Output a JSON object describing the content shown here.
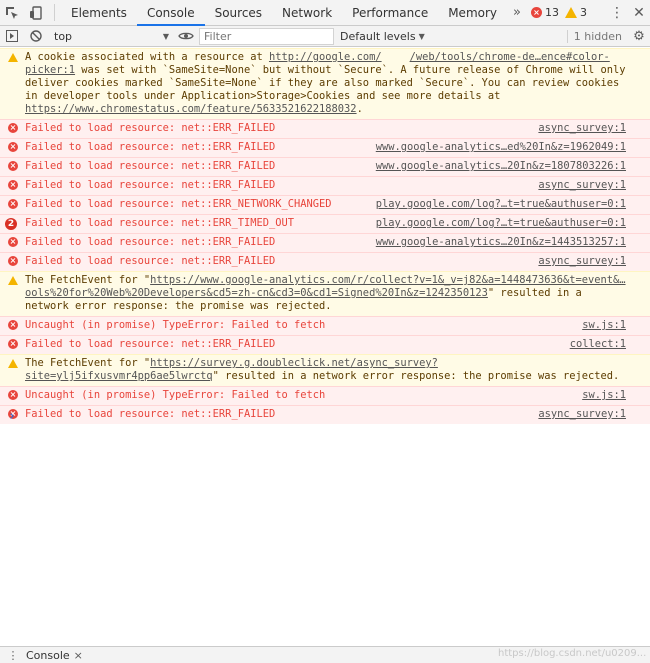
{
  "tabs": {
    "items": [
      "Elements",
      "Console",
      "Sources",
      "Network",
      "Performance",
      "Memory"
    ],
    "active": "Console",
    "more": "»"
  },
  "counters": {
    "errors": "13",
    "warnings": "3"
  },
  "toolbar": {
    "context": "top",
    "filter_placeholder": "Filter",
    "levels": "Default levels",
    "hidden": "1 hidden"
  },
  "messages": [
    {
      "type": "warning",
      "text_before": "A cookie associated with a resource at ",
      "link": "http://google.com/",
      "text_after": " was set with `SameSite=None` but without `Secure`. A future release of Chrome will only deliver cookies marked `SameSite=None` if they are also marked `Secure`. You can review cookies in developer tools under Application>Storage>Cookies and see more details at ",
      "link2": "https://www.chromestatus.com/feature/5633521622188032",
      "text_end": ".",
      "source": "/web/tools/chrome-de…ence#color-picker:1"
    },
    {
      "type": "error",
      "text": "Failed to load resource: net::ERR_FAILED",
      "source": "async_survey:1"
    },
    {
      "type": "error",
      "text": "Failed to load resource: net::ERR_FAILED",
      "source": "www.google-analytics…ed%20In&z=1962049:1"
    },
    {
      "type": "error",
      "text": "Failed to load resource: net::ERR_FAILED",
      "source": "www.google-analytics…20In&z=1807803226:1"
    },
    {
      "type": "error",
      "text": "Failed to load resource: net::ERR_FAILED",
      "source": "async_survey:1"
    },
    {
      "type": "error",
      "text": "Failed to load resource: net::ERR_NETWORK_CHANGED",
      "source": "play.google.com/log?…t=true&authuser=0:1"
    },
    {
      "type": "error-repeat",
      "count": "2",
      "text": "Failed to load resource: net::ERR_TIMED_OUT",
      "source": "play.google.com/log?…t=true&authuser=0:1"
    },
    {
      "type": "error",
      "text": "Failed to load resource: net::ERR_FAILED",
      "source": "www.google-analytics…20In&z=1443513257:1"
    },
    {
      "type": "error",
      "text": "Failed to load resource: net::ERR_FAILED",
      "source": "async_survey:1"
    },
    {
      "type": "warning",
      "text_before": "The FetchEvent for \"",
      "link": "https://www.google-analytics.com/r/collect?v=1&_v=j82&a=1448473636&t=event&…ools%20for%20Web%20Developers&cd5=zh-cn&cd3=0&cd1=Signed%20In&z=1242350123",
      "text_after": "\" resulted in a network error response: the promise was rejected.",
      "source": ""
    },
    {
      "type": "error",
      "text": "Uncaught (in promise) TypeError: Failed to fetch",
      "source": "sw.js:1"
    },
    {
      "type": "error",
      "text": "Failed to load resource: net::ERR_FAILED",
      "source": "collect:1"
    },
    {
      "type": "warning",
      "text_before": "The FetchEvent for \"",
      "link": "https://survey.g.doubleclick.net/async_survey?site=ylj5ifxusvmr4pp6ae5lwrctq",
      "text_after": "\" resulted in a network error response: the promise was rejected.",
      "source": ""
    },
    {
      "type": "error",
      "text": "Uncaught (in promise) TypeError: Failed to fetch",
      "source": "sw.js:1"
    },
    {
      "type": "error",
      "text": "Failed to load resource: net::ERR_FAILED",
      "source": "async_survey:1"
    }
  ],
  "prompt": "›",
  "drawer": {
    "label": "Console",
    "menu": "⋮",
    "close": "×"
  },
  "watermark": "https://blog.csdn.net/u0209..."
}
